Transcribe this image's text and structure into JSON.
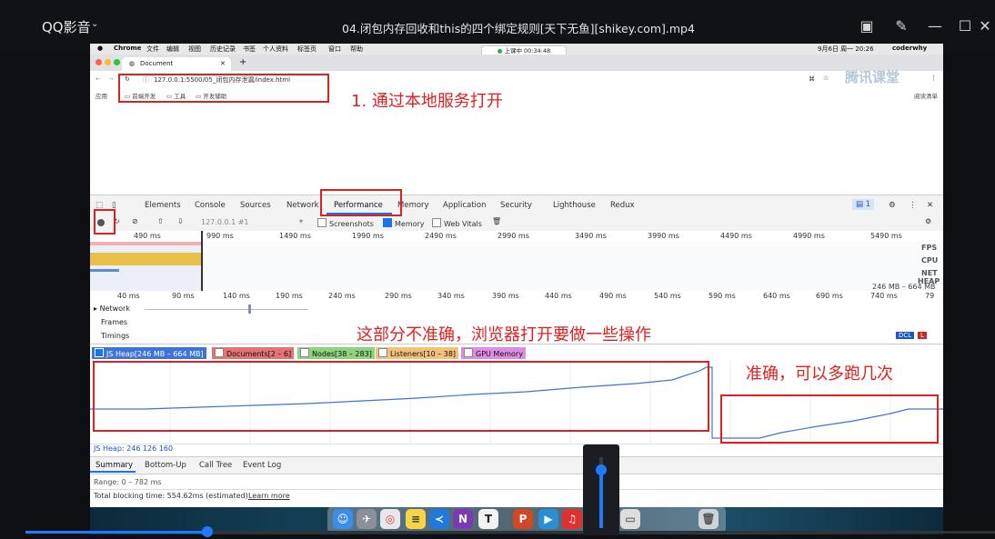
{
  "player": {
    "app_name": "QQ影音",
    "title": "04.闭包内存回收和this的四个绑定规则[天下无鱼][shikey.com].mp4",
    "progress_fraction": 0.19,
    "volume_fraction": 0.85
  },
  "macos": {
    "menubar": [
      "Chrome",
      "文件",
      "编辑",
      "视图",
      "历史记录",
      "书签",
      "个人资料",
      "标签页",
      "窗口",
      "帮助"
    ],
    "clock": "9月6日 周一 20:26",
    "user": "coderwhy",
    "recording": "上课中 00:34:48"
  },
  "browser": {
    "tab_title": "Document",
    "new_tab": "+",
    "url": "127.0.0.1:5500/05_闭包内存泄漏/index.html",
    "bookmarks": [
      "应用",
      "前端开发",
      "工具",
      "开发辅助"
    ],
    "reading_list": "阅读清单",
    "watermark": "腾讯课堂"
  },
  "devtools": {
    "tabs": [
      "Elements",
      "Console",
      "Sources",
      "Network",
      "Performance",
      "Memory",
      "Application",
      "Security",
      "Lighthouse",
      "Redux"
    ],
    "active_tab": "Performance",
    "issues_count": "1",
    "profile_select": "127.0.0.1 #1",
    "checkboxes": {
      "screenshots": "Screenshots",
      "memory": "Memory",
      "web_vitals": "Web Vitals"
    },
    "overview_ticks": [
      "490 ms",
      "990 ms",
      "1490 ms",
      "1990 ms",
      "2490 ms",
      "2990 ms",
      "3490 ms",
      "3990 ms",
      "4490 ms",
      "4990 ms",
      "5490 ms"
    ],
    "overview_labels": {
      "fps": "FPS",
      "cpu": "CPU",
      "net": "NET",
      "heap": "HEAP",
      "heap_range": "246 MB – 664 MB"
    },
    "detail_ticks": [
      "40 ms",
      "90 ms",
      "140 ms",
      "190 ms",
      "240 ms",
      "290 ms",
      "340 ms",
      "390 ms",
      "440 ms",
      "490 ms",
      "540 ms",
      "590 ms",
      "640 ms",
      "690 ms",
      "740 ms",
      "79"
    ],
    "tracks": {
      "network": "Network",
      "frames": "Frames",
      "timings": "Timings",
      "dcl": "DCL",
      "l": "L"
    },
    "counters": [
      {
        "label": "JS Heap[246 MB – 664 MB]",
        "color": "#3d74d8",
        "checked": true
      },
      {
        "label": "Documents[2 – 6]",
        "color": "#d83c3c",
        "checked": false
      },
      {
        "label": "Nodes[38 – 283]",
        "color": "#5dbb4a",
        "checked": false
      },
      {
        "label": "Listeners[10 – 38]",
        "color": "#e8a33c",
        "checked": false
      },
      {
        "label": "GPU Memory",
        "color": "#c04bc9",
        "checked": false
      }
    ],
    "js_heap": "JS Heap: 246 126 160",
    "sub_tabs": [
      "Summary",
      "Bottom-Up",
      "Call Tree",
      "Event Log"
    ],
    "range_text": "Range: 0 – 782 ms",
    "total_blocking": "Total blocking time: 554.62ms (estimated)",
    "learn_more": "Learn more"
  },
  "annotations": {
    "a1": "1. 通过本地服务打开",
    "a2": "这部分不准确，浏览器打开要做一些操作",
    "a3": "准确，可以多跑几次"
  },
  "dock": [
    "finder-icon",
    "launchpad-icon",
    "chrome-icon",
    "notes-icon",
    "vscode-icon",
    "onenote-icon",
    "typora-icon",
    "powerpoint-icon",
    "tencent-class-icon",
    "netease-music-icon",
    "screenshot-icon",
    "trash-icon"
  ]
}
